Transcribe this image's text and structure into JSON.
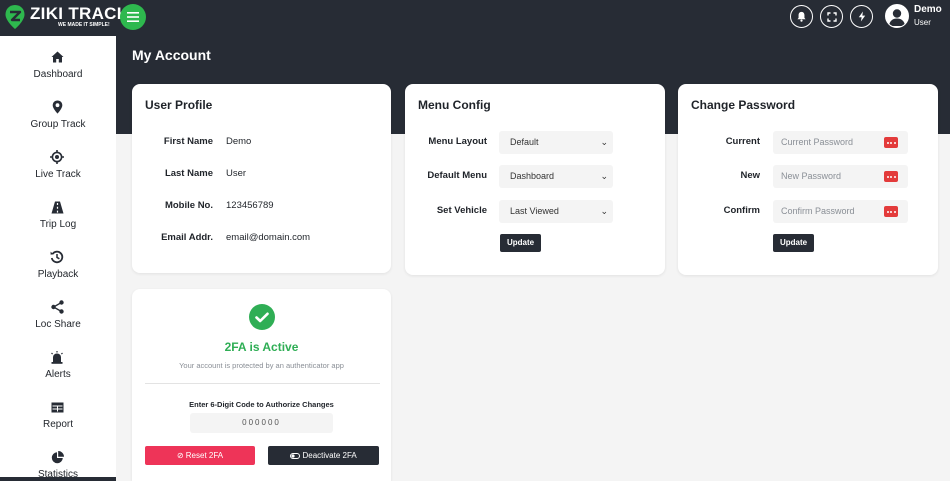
{
  "brand": {
    "name": "ZIKI TRACK",
    "tagline": "WE MADE IT SIMPLE!"
  },
  "header": {
    "user_name": "Demo",
    "user_role": "User",
    "icons": [
      "bell-icon",
      "fullscreen-icon",
      "bolt-icon",
      "user-avatar-icon"
    ]
  },
  "sidebar": {
    "items": [
      {
        "label": "Dashboard",
        "icon": "home-icon"
      },
      {
        "label": "Group Track",
        "icon": "map-pin-icon"
      },
      {
        "label": "Live Track",
        "icon": "crosshair-icon"
      },
      {
        "label": "Trip Log",
        "icon": "road-icon"
      },
      {
        "label": "Playback",
        "icon": "history-icon"
      },
      {
        "label": "Loc Share",
        "icon": "share-icon"
      },
      {
        "label": "Alerts",
        "icon": "alarm-icon"
      },
      {
        "label": "Report",
        "icon": "table-icon"
      },
      {
        "label": "Statistics",
        "icon": "pie-chart-icon"
      }
    ]
  },
  "page": {
    "title": "My Account"
  },
  "profile": {
    "title": "User Profile",
    "fields": [
      {
        "label": "First Name",
        "value": "Demo"
      },
      {
        "label": "Last Name",
        "value": "User"
      },
      {
        "label": "Mobile No.",
        "value": "123456789"
      },
      {
        "label": "Email Addr.",
        "value": "email@domain.com"
      }
    ]
  },
  "menu_config": {
    "title": "Menu Config",
    "fields": [
      {
        "label": "Menu Layout",
        "value": "Default"
      },
      {
        "label": "Default Menu",
        "value": "Dashboard"
      },
      {
        "label": "Set Vehicle",
        "value": "Last Viewed"
      }
    ],
    "update_label": "Update"
  },
  "change_password": {
    "title": "Change Password",
    "fields": [
      {
        "label": "Current",
        "placeholder": "Current Password"
      },
      {
        "label": "New",
        "placeholder": "New Password"
      },
      {
        "label": "Confirm",
        "placeholder": "Confirm Password"
      }
    ],
    "update_label": "Update"
  },
  "twofa": {
    "status": "2FA is Active",
    "description": "Your account is protected by an authenticator app",
    "code_label": "Enter 6-Digit Code to Authorize Changes",
    "code_placeholder": "000000",
    "reset_label": "Reset 2FA",
    "deactivate_label": "Deactivate 2FA"
  },
  "colors": {
    "dark": "#272c35",
    "accent_green": "#2eb84e",
    "success_green": "#2fae55",
    "danger_pink": "#ee3458",
    "eye_red": "#e33b3b"
  }
}
